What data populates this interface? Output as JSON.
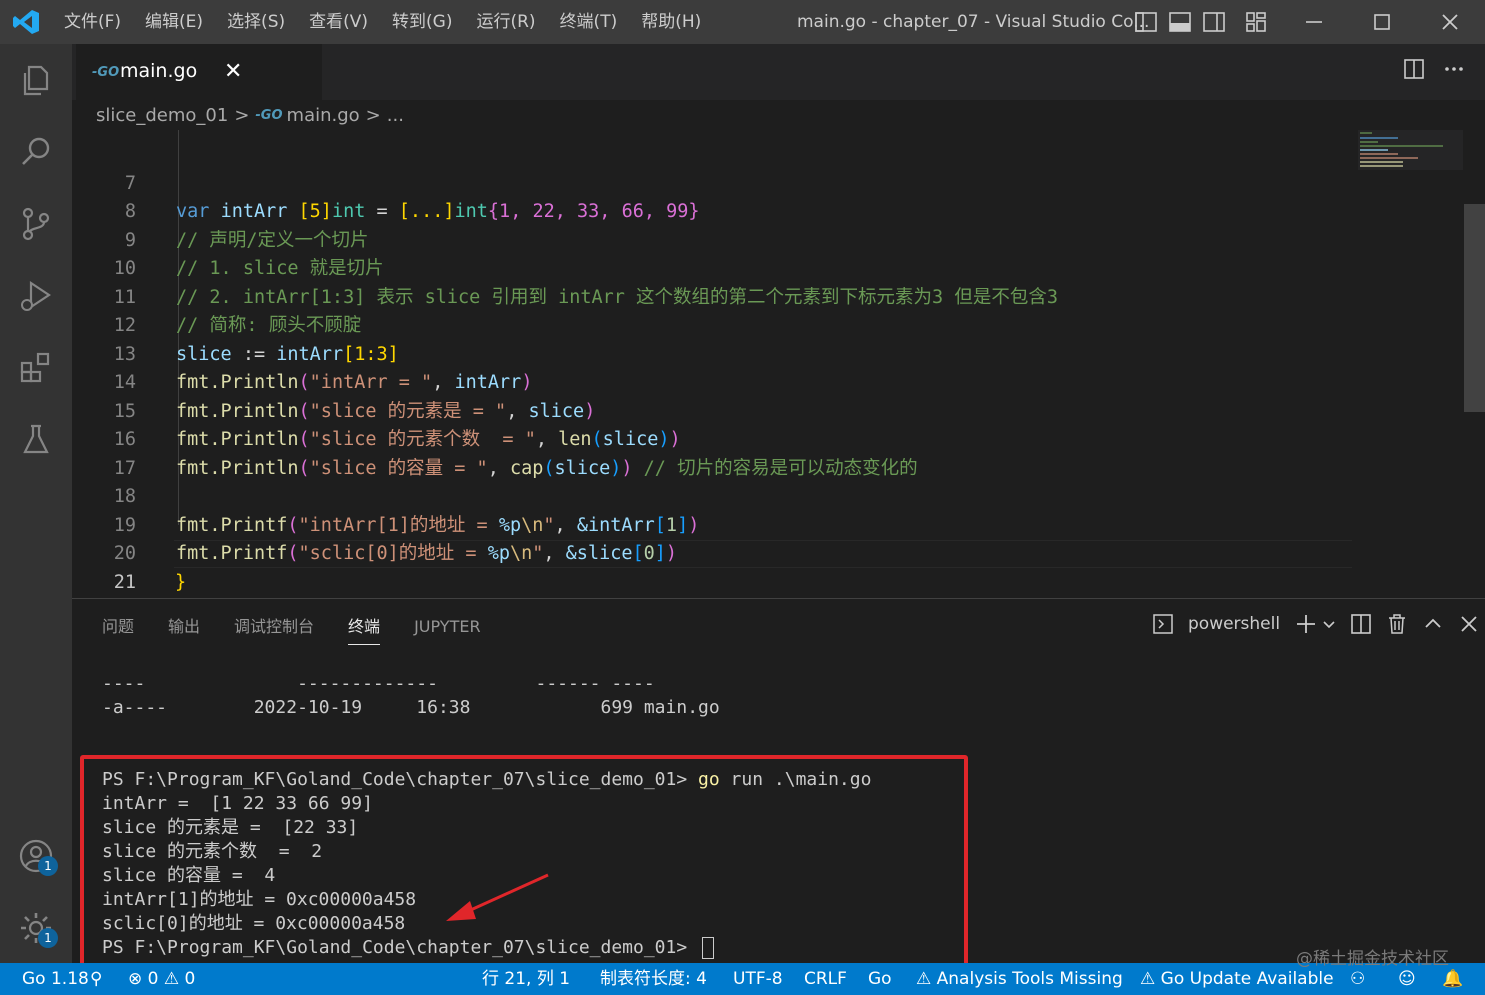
{
  "titlebar": {
    "menus": [
      "文件(F)",
      "编辑(E)",
      "选择(S)",
      "查看(V)",
      "转到(G)",
      "运行(R)",
      "终端(T)",
      "帮助(H)"
    ],
    "window_title": "main.go - chapter_07 - Visual Studio Co...",
    "icons": [
      "vscode-logo-icon",
      "toggle-primary-sidebar-icon",
      "toggle-panel-icon",
      "toggle-secondary-sidebar-icon",
      "customize-layout-icon",
      "minimize-icon",
      "maximize-icon",
      "close-icon"
    ]
  },
  "activitybar": {
    "icons": [
      "explorer-icon",
      "search-icon",
      "source-control-icon",
      "run-debug-icon",
      "extensions-icon",
      "testing-icon",
      "accounts-icon",
      "manage-gear-icon"
    ],
    "accounts_badge": "1",
    "manage_badge": "1"
  },
  "tabs": [
    {
      "label": "main.go",
      "icon": "go-file-icon",
      "close": "✕"
    }
  ],
  "breadcrumb": {
    "folder": "slice_demo_01",
    "file": "main.go",
    "more": "..."
  },
  "editor": {
    "lines": [
      {
        "n": "7"
      },
      {
        "n": "8"
      },
      {
        "n": "9"
      },
      {
        "n": "10"
      },
      {
        "n": "11"
      },
      {
        "n": "12"
      },
      {
        "n": "13"
      },
      {
        "n": "14"
      },
      {
        "n": "15"
      },
      {
        "n": "16"
      },
      {
        "n": "17"
      },
      {
        "n": "18"
      },
      {
        "n": "19"
      },
      {
        "n": "20"
      },
      {
        "n": "21"
      }
    ],
    "code": {
      "l7_kw": "var",
      "l7_name": "intArr",
      "l7_t1": "[5]",
      "l7_type": "int",
      "l7_eq": " = ",
      "l7_t2": "[...]",
      "l7_type2": "int",
      "l7_vals": "{1, 22, 33, 66, 99}",
      "l8": "// 声明/定义一个切片",
      "l9": "// 1. slice 就是切片",
      "l10": "// 2. intArr[1:3] 表示 slice 引用到 intArr 这个数组的第二个元素到下标元素为3 但是不包含3",
      "l11": "// 简称: 顾头不顾腚",
      "l12_a": "slice",
      "l12_b": " := ",
      "l12_c": "intArr",
      "l12_d": "[1:3]",
      "l13_fn": "fmt.Println",
      "l13_str": "\"intArr = \"",
      "l13_arg": "intArr",
      "l14_fn": "fmt.Println",
      "l14_str": "\"slice 的元素是 = \"",
      "l14_arg": "slice",
      "l15_fn": "fmt.Println",
      "l15_str": "\"slice 的元素个数  = \"",
      "l15_call": "len",
      "l15_arg": "slice",
      "l16_fn": "fmt.Println",
      "l16_str": "\"slice 的容量 = \"",
      "l16_call": "cap",
      "l16_arg": "slice",
      "l16_cmt": "// 切片的容易是可以动态变化的",
      "l18_fn": "fmt.Printf",
      "l18_str1": "\"intArr[1]的地址 = ",
      "l18_fmt": "%p",
      "l18_esc": "\\n",
      "l18_str2": "\"",
      "l18_arg": "&intArr",
      "l18_idx": "1",
      "l19_fn": "fmt.Printf",
      "l19_str1": "\"sclic[0]的地址 = ",
      "l19_fmt": "%p",
      "l19_esc": "\\n",
      "l19_str2": "\"",
      "l19_arg": "&slice",
      "l19_idx": "0",
      "l20": "}"
    }
  },
  "panel": {
    "tabs": [
      "问题",
      "输出",
      "调试控制台",
      "终端",
      "JUPYTER"
    ],
    "active_tab": "终端",
    "shell": "powershell",
    "terminal": {
      "header_dashes": "----              -------------         ------ ----",
      "dir_row": "-a----        2022-10-19     16:38            699 main.go",
      "prompt1": "PS F:\\Program_KF\\Goland_Code\\chapter_07\\slice_demo_01> ",
      "cmd_go": "go",
      "cmd_rest": " run .\\main.go",
      "out": [
        "intArr =  [1 22 33 66 99]",
        "slice 的元素是 =  [22 33]",
        "slice 的元素个数  =  2",
        "slice 的容量 =  4",
        "intArr[1]的地址 = 0xc00000a458",
        "sclic[0]的地址 = 0xc00000a458"
      ],
      "prompt2": "PS F:\\Program_KF\\Goland_Code\\chapter_07\\slice_demo_01> "
    }
  },
  "statusbar": {
    "go_version": "Go 1.18",
    "errors": "0",
    "warnings": "0",
    "position": "行 21, 列 1",
    "tab_size": "制表符长度: 4",
    "encoding": "UTF-8",
    "eol": "CRLF",
    "language": "Go",
    "analysis": "Analysis Tools Missing",
    "update": "Go Update Available"
  },
  "watermark": "@稀土掘金技术社区",
  "colors": {
    "accent": "#007acc",
    "highlight": "#e0262a"
  }
}
